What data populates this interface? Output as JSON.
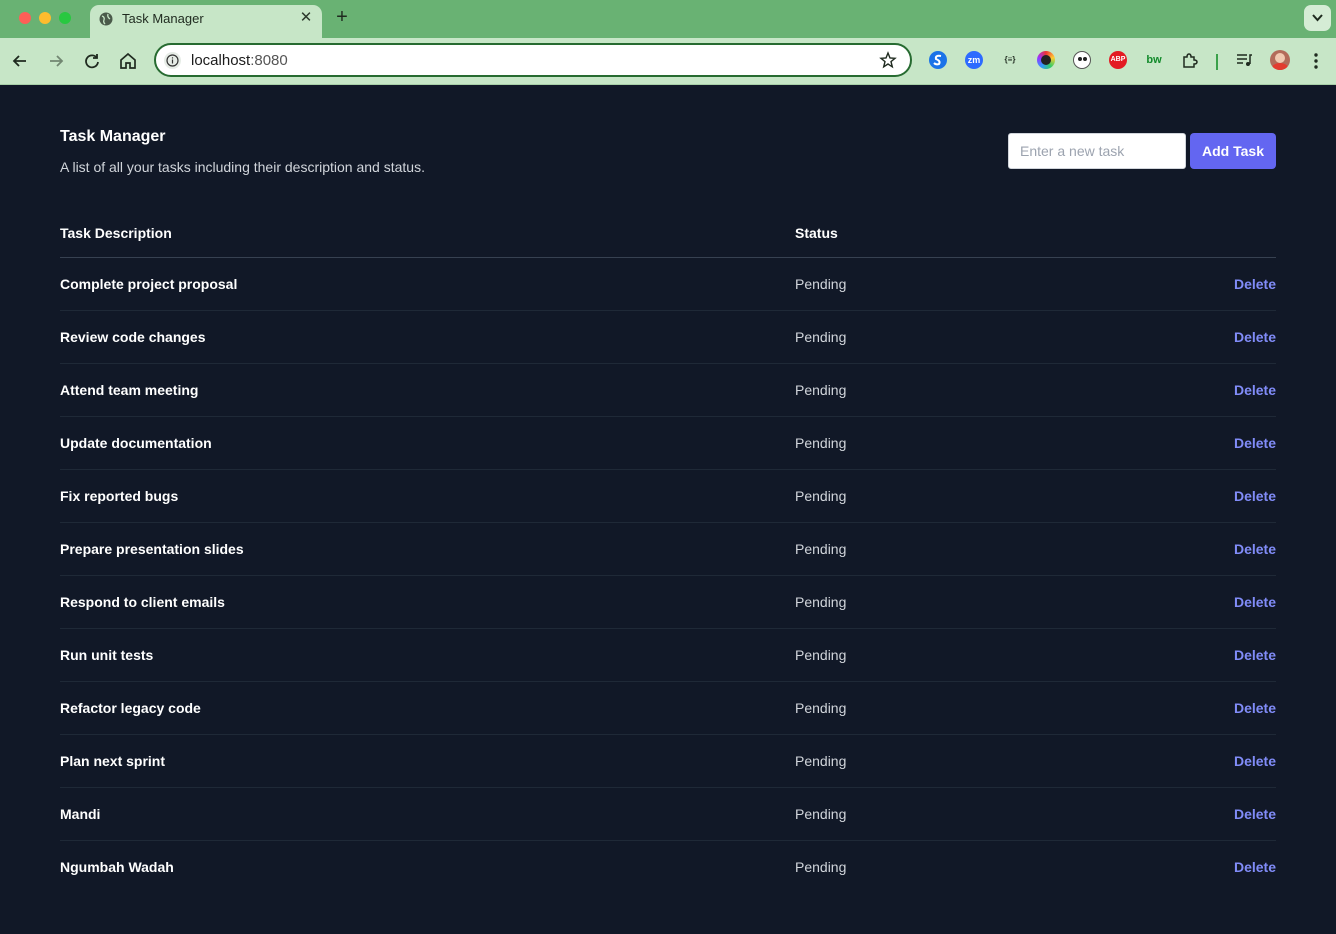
{
  "browser": {
    "tab_title": "Task Manager",
    "new_tab_label": "+",
    "tab_close_label": "✕",
    "url_host": "localhost",
    "url_port": ":8080",
    "extensions": [
      "zm",
      "{≡}",
      "ABP",
      "bw"
    ]
  },
  "header": {
    "title": "Task Manager",
    "subtitle": "A list of all your tasks including their description and status.",
    "input_placeholder": "Enter a new task",
    "input_value": "",
    "add_button_label": "Add Task"
  },
  "table": {
    "columns": [
      "Task Description",
      "Status"
    ],
    "delete_label": "Delete",
    "rows": [
      {
        "description": "Complete project proposal",
        "status": "Pending"
      },
      {
        "description": "Review code changes",
        "status": "Pending"
      },
      {
        "description": "Attend team meeting",
        "status": "Pending"
      },
      {
        "description": "Update documentation",
        "status": "Pending"
      },
      {
        "description": "Fix reported bugs",
        "status": "Pending"
      },
      {
        "description": "Prepare presentation slides",
        "status": "Pending"
      },
      {
        "description": "Respond to client emails",
        "status": "Pending"
      },
      {
        "description": "Run unit tests",
        "status": "Pending"
      },
      {
        "description": "Refactor legacy code",
        "status": "Pending"
      },
      {
        "description": "Plan next sprint",
        "status": "Pending"
      },
      {
        "description": "Mandi",
        "status": "Pending"
      },
      {
        "description": "Ngumbah Wadah",
        "status": "Pending"
      }
    ]
  },
  "colors": {
    "page_background": "#111827",
    "accent": "#6366f1",
    "delete_link": "#818cf8",
    "chrome_frame": "#69b273"
  }
}
